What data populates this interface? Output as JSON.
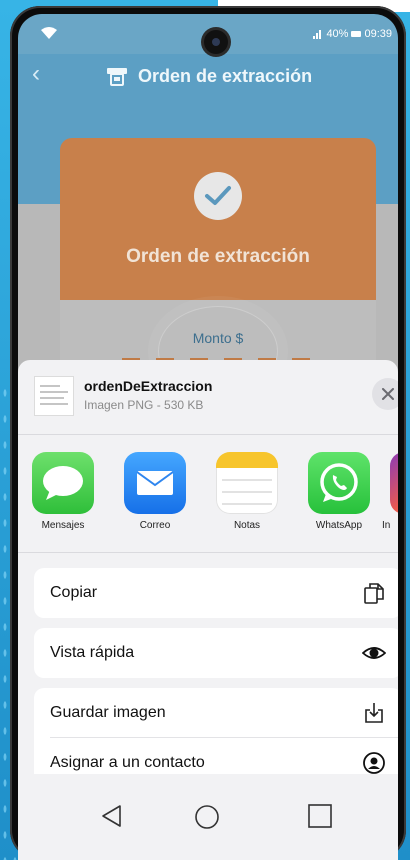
{
  "status_bar": {
    "battery": "40%",
    "time": "09:39",
    "icons": [
      "wifi-icon",
      "signal-icon",
      "battery-icon",
      "front-camera"
    ]
  },
  "app": {
    "title": "Orden de extracción",
    "card_title": "Orden de extracción",
    "amount_label": "Monto $",
    "accent_color": "#c8804b",
    "header_color": "#5c9fc4"
  },
  "share_sheet": {
    "file_name": "ordenDeExtraccion",
    "file_meta": "Imagen PNG - 530 KB",
    "apps": [
      {
        "label": "Mensajes",
        "icon": "messages-icon"
      },
      {
        "label": "Correo",
        "icon": "mail-icon"
      },
      {
        "label": "Notas",
        "icon": "notes-icon"
      },
      {
        "label": "WhatsApp",
        "icon": "whatsapp-icon"
      },
      {
        "label": "In",
        "icon": "instagram-icon"
      }
    ],
    "actions": [
      {
        "label": "Copiar",
        "icon": "copy-icon"
      },
      {
        "label": "Vista rápida",
        "icon": "eye-icon"
      },
      {
        "label": "Guardar imagen",
        "icon": "save-image-icon"
      },
      {
        "label": "Asignar a un contacto",
        "icon": "contact-icon"
      }
    ]
  },
  "nav": {
    "icons": [
      "back-triangle-icon",
      "home-circle-icon",
      "recent-square-icon"
    ]
  }
}
